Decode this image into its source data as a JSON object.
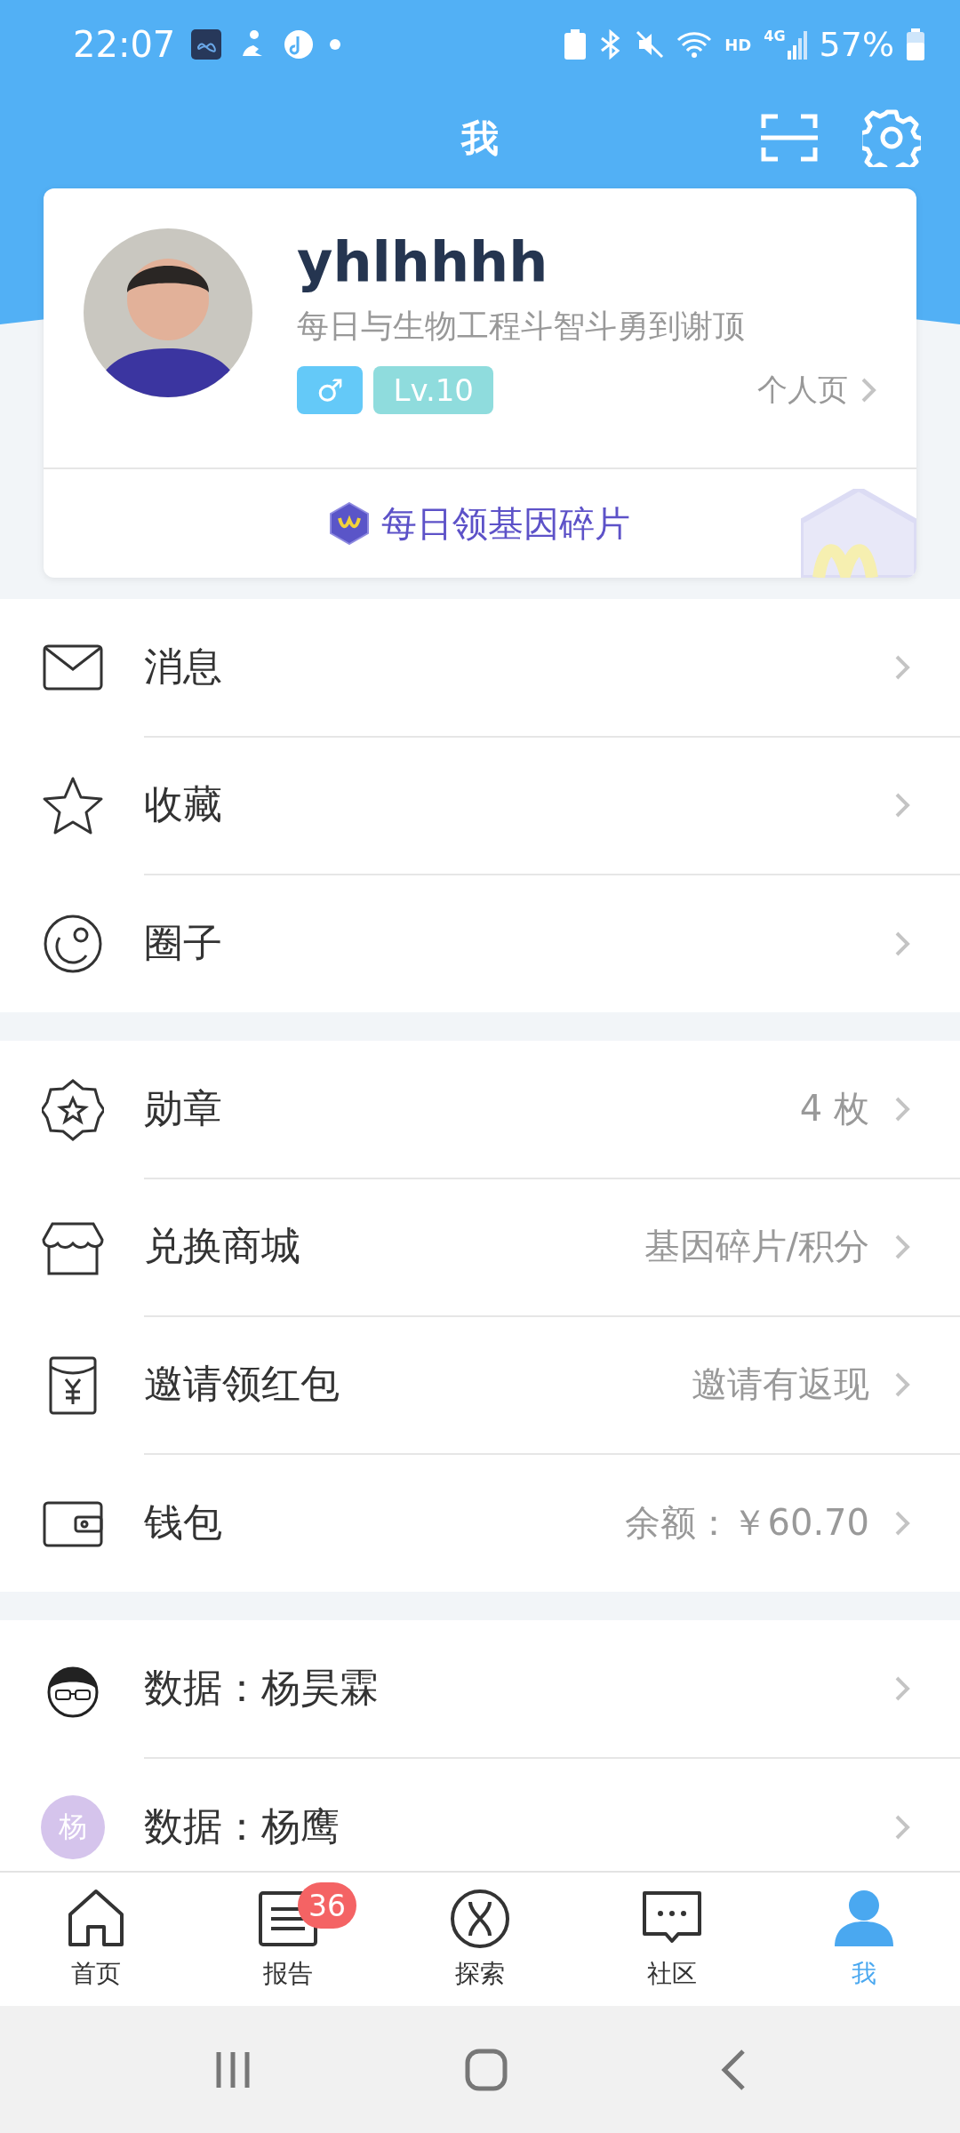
{
  "status_bar": {
    "time": "22:07",
    "network": "4G",
    "hd": "HD",
    "battery": "57%"
  },
  "header": {
    "title": "我"
  },
  "profile": {
    "name": "yhlhhhh",
    "bio": "每日与生物工程斗智斗勇到谢顶",
    "gender": "♂",
    "level": "Lv.10",
    "profile_link": "个人页",
    "daily_reward": "每日领基因碎片"
  },
  "menu_groups": [
    [
      {
        "kind": "mail",
        "label": "消息"
      },
      {
        "kind": "star",
        "label": "收藏"
      },
      {
        "kind": "circle",
        "label": "圈子"
      }
    ],
    [
      {
        "kind": "medal",
        "label": "勋章",
        "value": "4 枚"
      },
      {
        "kind": "shop",
        "label": "兑换商城",
        "value": "基因碎片/积分"
      },
      {
        "kind": "envelope",
        "label": "邀请领红包",
        "value": "邀请有返现"
      },
      {
        "kind": "wallet",
        "label": "钱包",
        "value": "余额：￥60.70"
      }
    ],
    [
      {
        "kind": "cartoon",
        "label": "数据：杨昊霖"
      },
      {
        "kind": "initial",
        "initial": "杨",
        "color": "#d5c4ec",
        "label": "数据：杨鹰"
      }
    ]
  ],
  "tabs": [
    {
      "kind": "home",
      "label": "首页",
      "selected": false
    },
    {
      "kind": "report",
      "label": "报告",
      "selected": false,
      "badge": "36"
    },
    {
      "kind": "explore",
      "label": "探索",
      "selected": false
    },
    {
      "kind": "chat",
      "label": "社区",
      "selected": false
    },
    {
      "kind": "person",
      "label": "我",
      "selected": true
    }
  ]
}
